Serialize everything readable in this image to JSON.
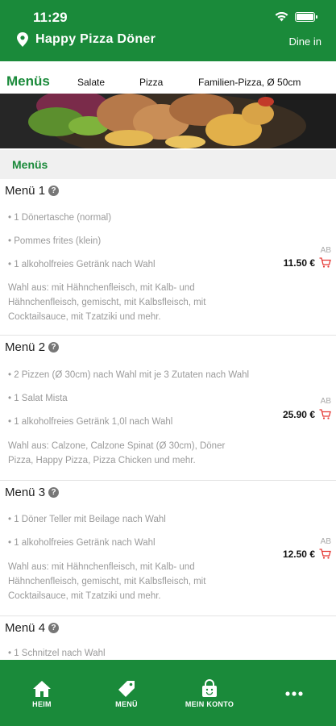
{
  "status": {
    "time": "11:29"
  },
  "header": {
    "store_name": "Happy Pizza Döner",
    "mode": "Dine in"
  },
  "tabs": [
    {
      "label": "Menüs",
      "active": true
    },
    {
      "label": "Salate",
      "active": false
    },
    {
      "label": "Pizza",
      "active": false
    },
    {
      "label": "Familien-Pizza, Ø 50cm",
      "active": false
    }
  ],
  "section": {
    "title": "Menüs"
  },
  "items": [
    {
      "title": "Menü 1",
      "bullets": [
        "• 1 Dönertasche (normal)",
        "• Pommes frites (klein)",
        "• 1 alkoholfreies Getränk nach Wahl"
      ],
      "description": "Wahl aus: mit Hähnchenfleisch, mit Kalb- und Hähnchenfleisch, gemischt, mit Kalbsfleisch, mit Cocktailsauce, mit Tzatziki und mehr.",
      "price_prefix": "AB",
      "price": "11.50 €"
    },
    {
      "title": "Menü 2",
      "bullets": [
        "• 2 Pizzen (Ø 30cm) nach Wahl mit je 3 Zutaten nach Wahl",
        "• 1 Salat Mista",
        "• 1 alkoholfreies Getränk 1,0l nach Wahl"
      ],
      "description": "Wahl aus: Calzone, Calzone Spinat (Ø 30cm), Döner Pizza, Happy Pizza, Pizza Chicken und mehr.",
      "price_prefix": "AB",
      "price": "25.90 €"
    },
    {
      "title": "Menü 3",
      "bullets": [
        "• 1 Döner Teller mit Beilage nach Wahl",
        "• 1 alkoholfreies Getränk nach Wahl"
      ],
      "description": "Wahl aus: mit Hähnchenfleisch, mit Kalb- und Hähnchenfleisch, gemischt, mit Kalbsfleisch, mit Cocktailsauce, mit Tzatziki und mehr.",
      "price_prefix": "AB",
      "price": "12.50 €"
    },
    {
      "title": "Menü 4",
      "bullets": [
        "• 1 Schnitzel nach Wahl"
      ]
    }
  ],
  "nav": [
    {
      "label": "HEIM",
      "icon": "home-icon"
    },
    {
      "label": "MENÜ",
      "icon": "tag-icon"
    },
    {
      "label": "MEIN KONTO",
      "icon": "bag-icon"
    },
    {
      "label": "",
      "icon": "more-icon"
    }
  ],
  "colors": {
    "brand_green": "#1a8a3a",
    "cart_red": "#e53935"
  }
}
